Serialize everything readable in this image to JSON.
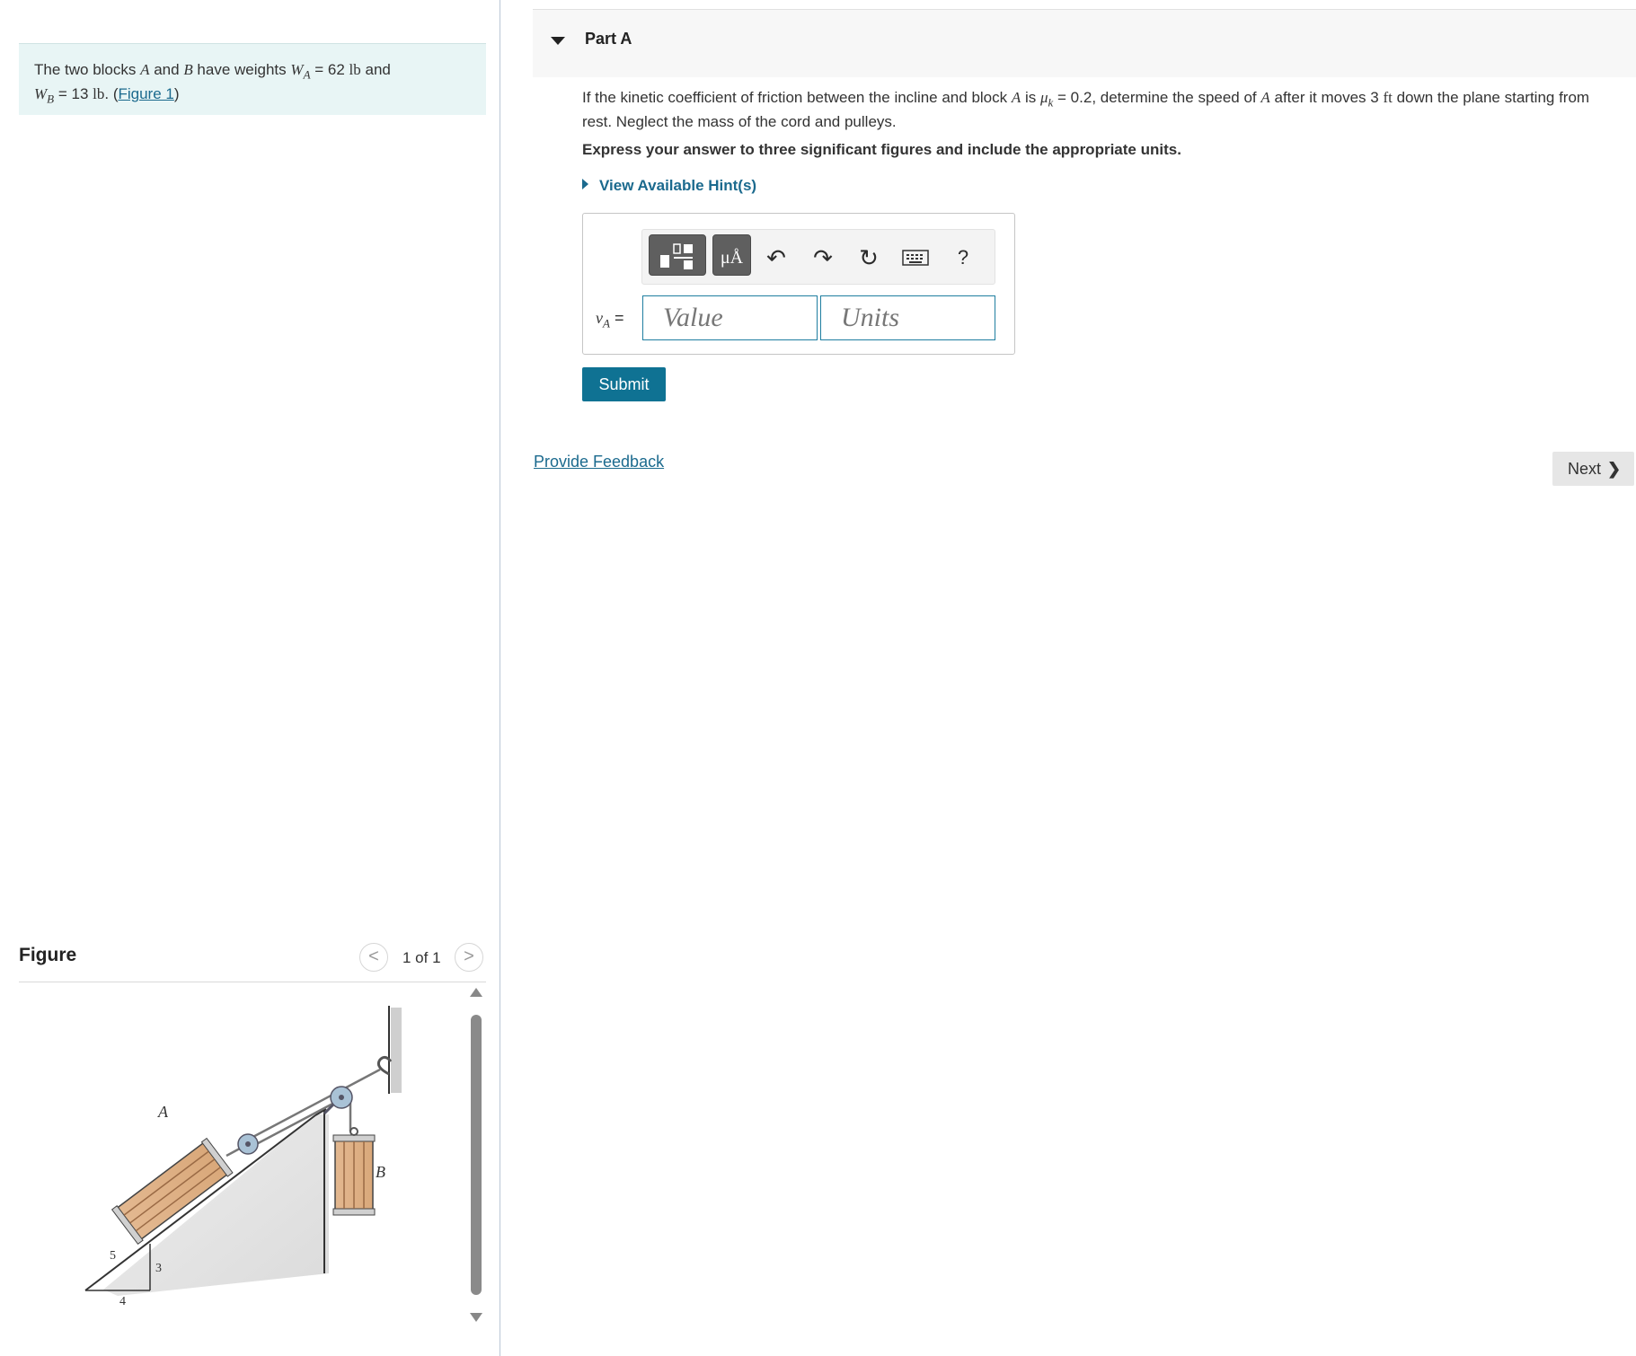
{
  "intro": {
    "text1": "The two blocks ",
    "a": "A",
    "text2": " and ",
    "b": "B",
    "text3": " have weights ",
    "wa_var": "W",
    "wa_sub": "A",
    "wa_eq": " = 62 ",
    "unit_lb": "lb",
    "text4": " and",
    "wb_var": "W",
    "wb_sub": "B",
    "wb_eq": " = 13 ",
    "unit_lb2": "lb",
    "text5": ". (",
    "figure_link": "Figure 1",
    "text6": ")"
  },
  "figure": {
    "title": "Figure",
    "pager": "1 of 1",
    "prev_glyph": "<",
    "next_glyph": ">",
    "labels": {
      "block_a": "A",
      "block_b": "B",
      "slope_5": "5",
      "slope_3": "3",
      "slope_4": "4"
    }
  },
  "part": {
    "title": "Part A",
    "q1": "If the kinetic coefficient of friction between the incline and block ",
    "q_a": "A",
    "q2": " is ",
    "mu": "μ",
    "mu_sub": "k",
    "q3": " = 0.2, determine the speed of ",
    "q_a2": "A",
    "q4": " after it moves 3 ",
    "ft": "ft",
    "q5": " down the plane starting from rest. Neglect the mass of the cord and pulleys.",
    "instruction": "Express your answer to three significant figures and include the appropriate units.",
    "hint": "View Available Hint(s)"
  },
  "answer": {
    "var": "v",
    "var_sub": "A",
    "eq": " =",
    "value_placeholder": "Value",
    "units_placeholder": "Units",
    "toolbar": {
      "templates_icon": "templates-icon",
      "units_icon_text": "μÅ",
      "undo": "↶",
      "redo": "↷",
      "reset": "↻",
      "help": "?"
    }
  },
  "actions": {
    "submit": "Submit",
    "feedback": "Provide Feedback",
    "next": "Next",
    "next_glyph": "❯"
  }
}
